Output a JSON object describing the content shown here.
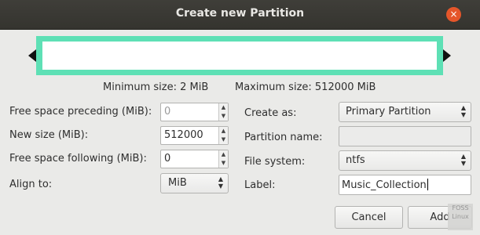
{
  "window": {
    "title": "Create new Partition",
    "close_glyph": "×"
  },
  "size_info": {
    "minimum": "Minimum size: 2 MiB",
    "maximum": "Maximum size: 512000 MiB"
  },
  "left_form": {
    "free_preceding": {
      "label": "Free space preceding (MiB):",
      "value": "0"
    },
    "new_size": {
      "label": "New size (MiB):",
      "value": "512000"
    },
    "free_following": {
      "label": "Free space following (MiB):",
      "value": "0"
    },
    "align_to": {
      "label": "Align to:",
      "value": "MiB"
    }
  },
  "right_form": {
    "create_as": {
      "label": "Create as:",
      "value": "Primary Partition"
    },
    "partition_name": {
      "label": "Partition name:",
      "value": ""
    },
    "file_system": {
      "label": "File system:",
      "value": "ntfs"
    },
    "fs_label": {
      "label": "Label:",
      "value": "Music_Collection"
    }
  },
  "buttons": {
    "cancel": "Cancel",
    "add": "Add"
  },
  "watermark": {
    "line1": "FOSS",
    "line2": "Linux"
  },
  "colors": {
    "partition_bar": "#5ee0b5",
    "close_button": "#e5562a",
    "titlebar": "#3a3934"
  }
}
